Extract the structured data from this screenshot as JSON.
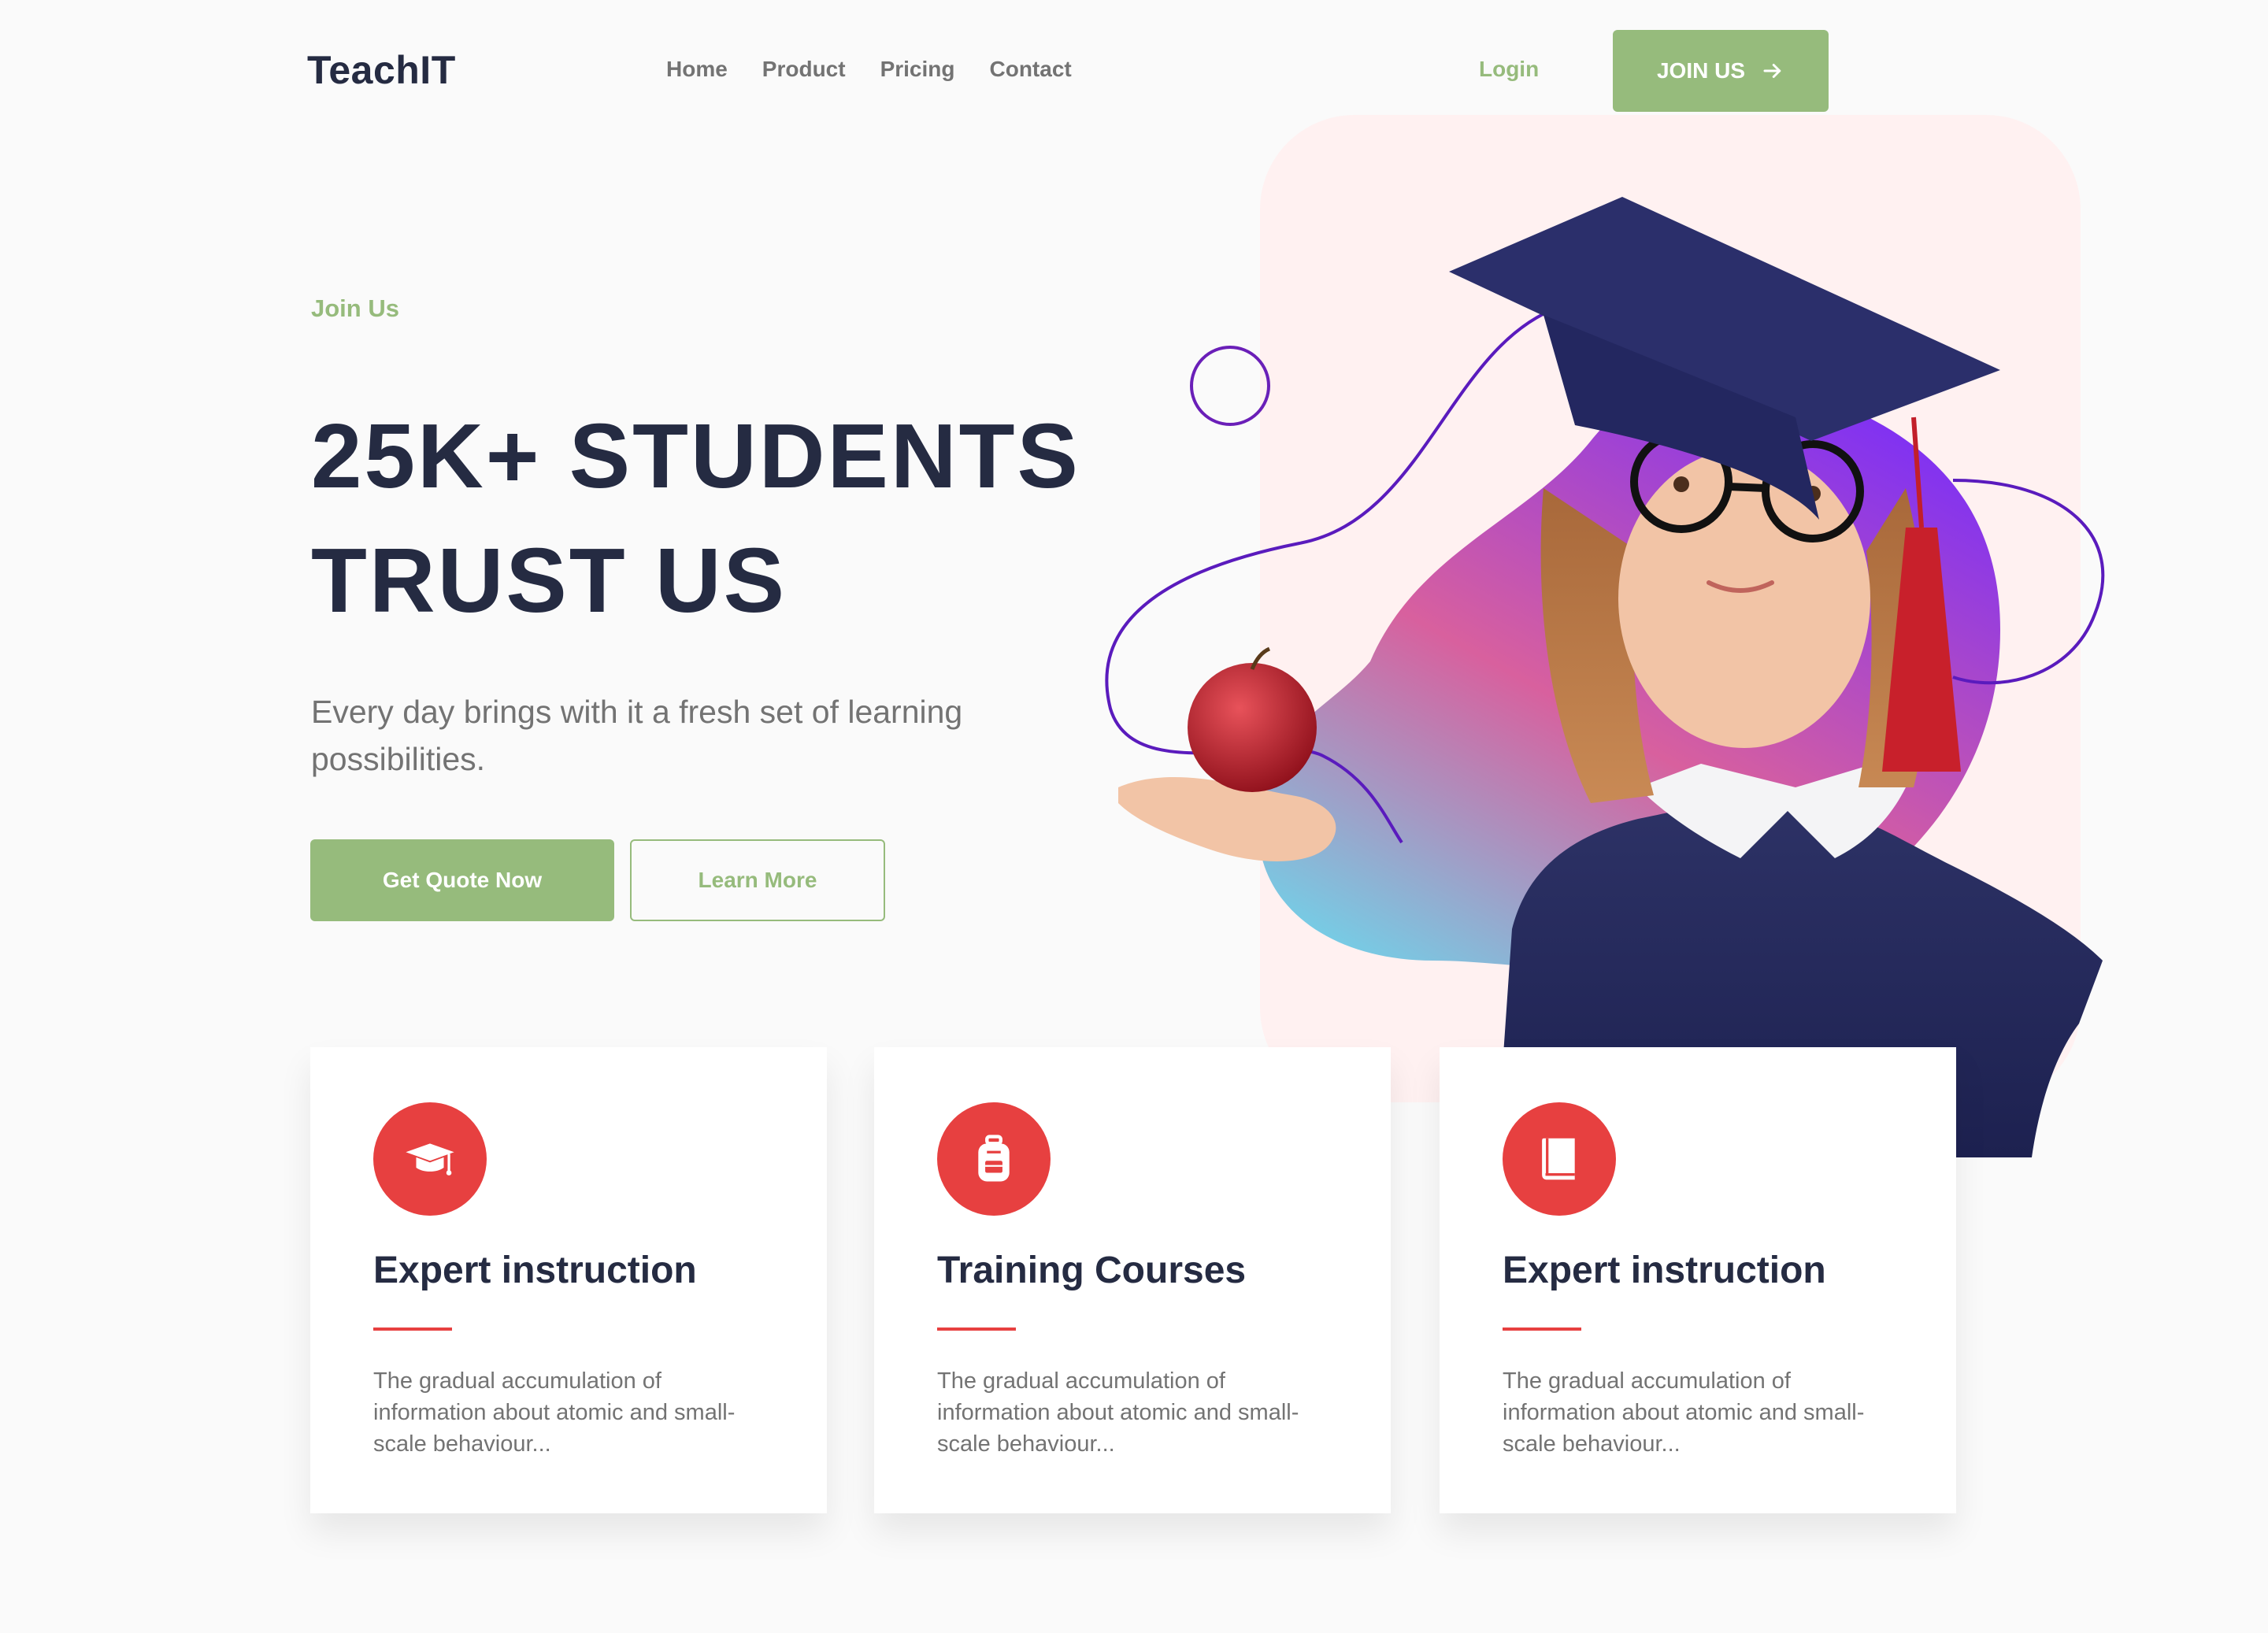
{
  "brand": {
    "logo": "TeachIT"
  },
  "nav": {
    "items": [
      {
        "label": "Home"
      },
      {
        "label": "Product"
      },
      {
        "label": "Pricing"
      },
      {
        "label": "Contact"
      }
    ],
    "login_label": "Login",
    "join_label": "JOIN US",
    "join_icon": "arrow-right-icon"
  },
  "hero": {
    "eyebrow": "Join Us",
    "title_line1": "25K+ STUDENTS",
    "title_line2": "TRUST US",
    "subtitle": "Every day brings with it a fresh set of learning possibilities.",
    "primary_button": "Get Quote Now",
    "secondary_button": "Learn More",
    "image_alt": "girl-in-graduation-cap-holding-apple"
  },
  "cards": [
    {
      "icon": "graduation-cap-icon",
      "title": "Expert instruction",
      "text": "The gradual accumulation of information about atomic and small-scale behaviour..."
    },
    {
      "icon": "backpack-icon",
      "title": "Training Courses",
      "text": "The gradual accumulation of information about atomic and small-scale behaviour..."
    },
    {
      "icon": "book-icon",
      "title": "Expert instruction",
      "text": "The gradual accumulation of information about atomic and small-scale behaviour..."
    }
  ],
  "colors": {
    "primary_green": "#96bb7c",
    "heading_dark": "#252b42",
    "text_gray": "#737373",
    "accent_red": "#e74040",
    "hero_panel_pink": "#fff1f1",
    "blob_purple": "#7b2ff7",
    "blob_pink": "#e0609a",
    "blob_cyan": "#6fd4ea"
  }
}
